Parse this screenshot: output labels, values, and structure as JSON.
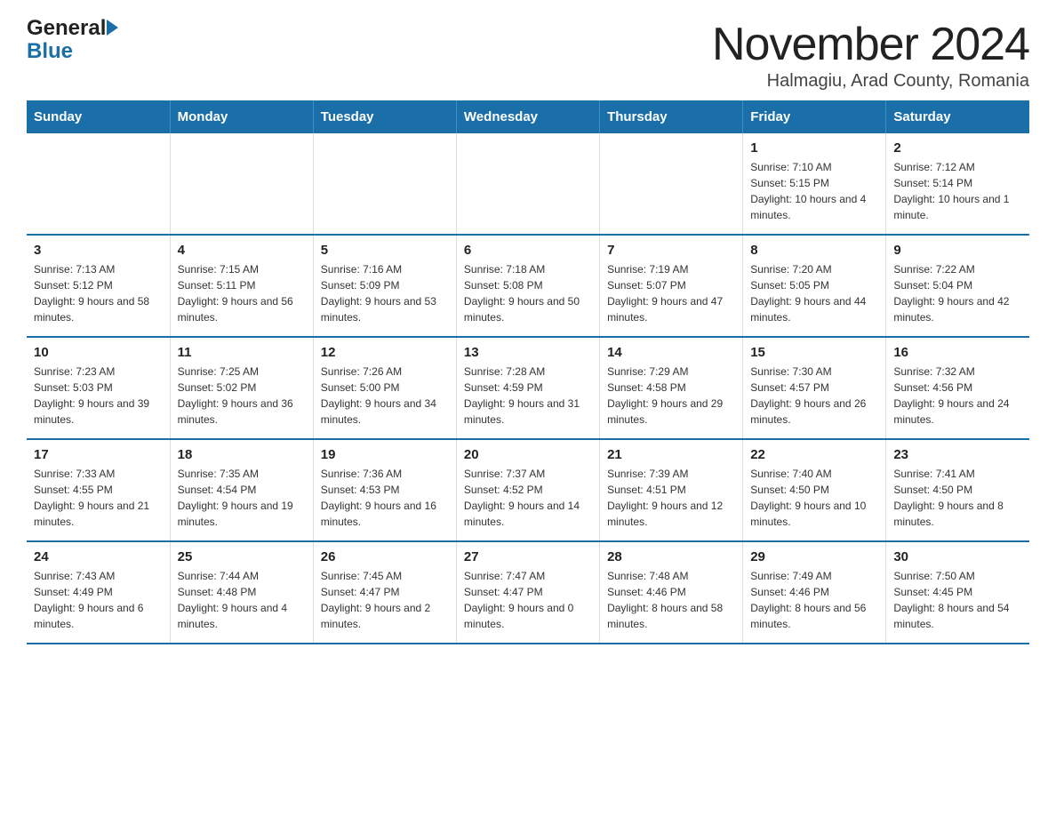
{
  "logo": {
    "general": "General",
    "blue": "Blue"
  },
  "header": {
    "month": "November 2024",
    "location": "Halmagiu, Arad County, Romania"
  },
  "weekdays": [
    "Sunday",
    "Monday",
    "Tuesday",
    "Wednesday",
    "Thursday",
    "Friday",
    "Saturday"
  ],
  "weeks": [
    [
      {
        "day": "",
        "sunrise": "",
        "sunset": "",
        "daylight": ""
      },
      {
        "day": "",
        "sunrise": "",
        "sunset": "",
        "daylight": ""
      },
      {
        "day": "",
        "sunrise": "",
        "sunset": "",
        "daylight": ""
      },
      {
        "day": "",
        "sunrise": "",
        "sunset": "",
        "daylight": ""
      },
      {
        "day": "",
        "sunrise": "",
        "sunset": "",
        "daylight": ""
      },
      {
        "day": "1",
        "sunrise": "Sunrise: 7:10 AM",
        "sunset": "Sunset: 5:15 PM",
        "daylight": "Daylight: 10 hours and 4 minutes."
      },
      {
        "day": "2",
        "sunrise": "Sunrise: 7:12 AM",
        "sunset": "Sunset: 5:14 PM",
        "daylight": "Daylight: 10 hours and 1 minute."
      }
    ],
    [
      {
        "day": "3",
        "sunrise": "Sunrise: 7:13 AM",
        "sunset": "Sunset: 5:12 PM",
        "daylight": "Daylight: 9 hours and 58 minutes."
      },
      {
        "day": "4",
        "sunrise": "Sunrise: 7:15 AM",
        "sunset": "Sunset: 5:11 PM",
        "daylight": "Daylight: 9 hours and 56 minutes."
      },
      {
        "day": "5",
        "sunrise": "Sunrise: 7:16 AM",
        "sunset": "Sunset: 5:09 PM",
        "daylight": "Daylight: 9 hours and 53 minutes."
      },
      {
        "day": "6",
        "sunrise": "Sunrise: 7:18 AM",
        "sunset": "Sunset: 5:08 PM",
        "daylight": "Daylight: 9 hours and 50 minutes."
      },
      {
        "day": "7",
        "sunrise": "Sunrise: 7:19 AM",
        "sunset": "Sunset: 5:07 PM",
        "daylight": "Daylight: 9 hours and 47 minutes."
      },
      {
        "day": "8",
        "sunrise": "Sunrise: 7:20 AM",
        "sunset": "Sunset: 5:05 PM",
        "daylight": "Daylight: 9 hours and 44 minutes."
      },
      {
        "day": "9",
        "sunrise": "Sunrise: 7:22 AM",
        "sunset": "Sunset: 5:04 PM",
        "daylight": "Daylight: 9 hours and 42 minutes."
      }
    ],
    [
      {
        "day": "10",
        "sunrise": "Sunrise: 7:23 AM",
        "sunset": "Sunset: 5:03 PM",
        "daylight": "Daylight: 9 hours and 39 minutes."
      },
      {
        "day": "11",
        "sunrise": "Sunrise: 7:25 AM",
        "sunset": "Sunset: 5:02 PM",
        "daylight": "Daylight: 9 hours and 36 minutes."
      },
      {
        "day": "12",
        "sunrise": "Sunrise: 7:26 AM",
        "sunset": "Sunset: 5:00 PM",
        "daylight": "Daylight: 9 hours and 34 minutes."
      },
      {
        "day": "13",
        "sunrise": "Sunrise: 7:28 AM",
        "sunset": "Sunset: 4:59 PM",
        "daylight": "Daylight: 9 hours and 31 minutes."
      },
      {
        "day": "14",
        "sunrise": "Sunrise: 7:29 AM",
        "sunset": "Sunset: 4:58 PM",
        "daylight": "Daylight: 9 hours and 29 minutes."
      },
      {
        "day": "15",
        "sunrise": "Sunrise: 7:30 AM",
        "sunset": "Sunset: 4:57 PM",
        "daylight": "Daylight: 9 hours and 26 minutes."
      },
      {
        "day": "16",
        "sunrise": "Sunrise: 7:32 AM",
        "sunset": "Sunset: 4:56 PM",
        "daylight": "Daylight: 9 hours and 24 minutes."
      }
    ],
    [
      {
        "day": "17",
        "sunrise": "Sunrise: 7:33 AM",
        "sunset": "Sunset: 4:55 PM",
        "daylight": "Daylight: 9 hours and 21 minutes."
      },
      {
        "day": "18",
        "sunrise": "Sunrise: 7:35 AM",
        "sunset": "Sunset: 4:54 PM",
        "daylight": "Daylight: 9 hours and 19 minutes."
      },
      {
        "day": "19",
        "sunrise": "Sunrise: 7:36 AM",
        "sunset": "Sunset: 4:53 PM",
        "daylight": "Daylight: 9 hours and 16 minutes."
      },
      {
        "day": "20",
        "sunrise": "Sunrise: 7:37 AM",
        "sunset": "Sunset: 4:52 PM",
        "daylight": "Daylight: 9 hours and 14 minutes."
      },
      {
        "day": "21",
        "sunrise": "Sunrise: 7:39 AM",
        "sunset": "Sunset: 4:51 PM",
        "daylight": "Daylight: 9 hours and 12 minutes."
      },
      {
        "day": "22",
        "sunrise": "Sunrise: 7:40 AM",
        "sunset": "Sunset: 4:50 PM",
        "daylight": "Daylight: 9 hours and 10 minutes."
      },
      {
        "day": "23",
        "sunrise": "Sunrise: 7:41 AM",
        "sunset": "Sunset: 4:50 PM",
        "daylight": "Daylight: 9 hours and 8 minutes."
      }
    ],
    [
      {
        "day": "24",
        "sunrise": "Sunrise: 7:43 AM",
        "sunset": "Sunset: 4:49 PM",
        "daylight": "Daylight: 9 hours and 6 minutes."
      },
      {
        "day": "25",
        "sunrise": "Sunrise: 7:44 AM",
        "sunset": "Sunset: 4:48 PM",
        "daylight": "Daylight: 9 hours and 4 minutes."
      },
      {
        "day": "26",
        "sunrise": "Sunrise: 7:45 AM",
        "sunset": "Sunset: 4:47 PM",
        "daylight": "Daylight: 9 hours and 2 minutes."
      },
      {
        "day": "27",
        "sunrise": "Sunrise: 7:47 AM",
        "sunset": "Sunset: 4:47 PM",
        "daylight": "Daylight: 9 hours and 0 minutes."
      },
      {
        "day": "28",
        "sunrise": "Sunrise: 7:48 AM",
        "sunset": "Sunset: 4:46 PM",
        "daylight": "Daylight: 8 hours and 58 minutes."
      },
      {
        "day": "29",
        "sunrise": "Sunrise: 7:49 AM",
        "sunset": "Sunset: 4:46 PM",
        "daylight": "Daylight: 8 hours and 56 minutes."
      },
      {
        "day": "30",
        "sunrise": "Sunrise: 7:50 AM",
        "sunset": "Sunset: 4:45 PM",
        "daylight": "Daylight: 8 hours and 54 minutes."
      }
    ]
  ]
}
